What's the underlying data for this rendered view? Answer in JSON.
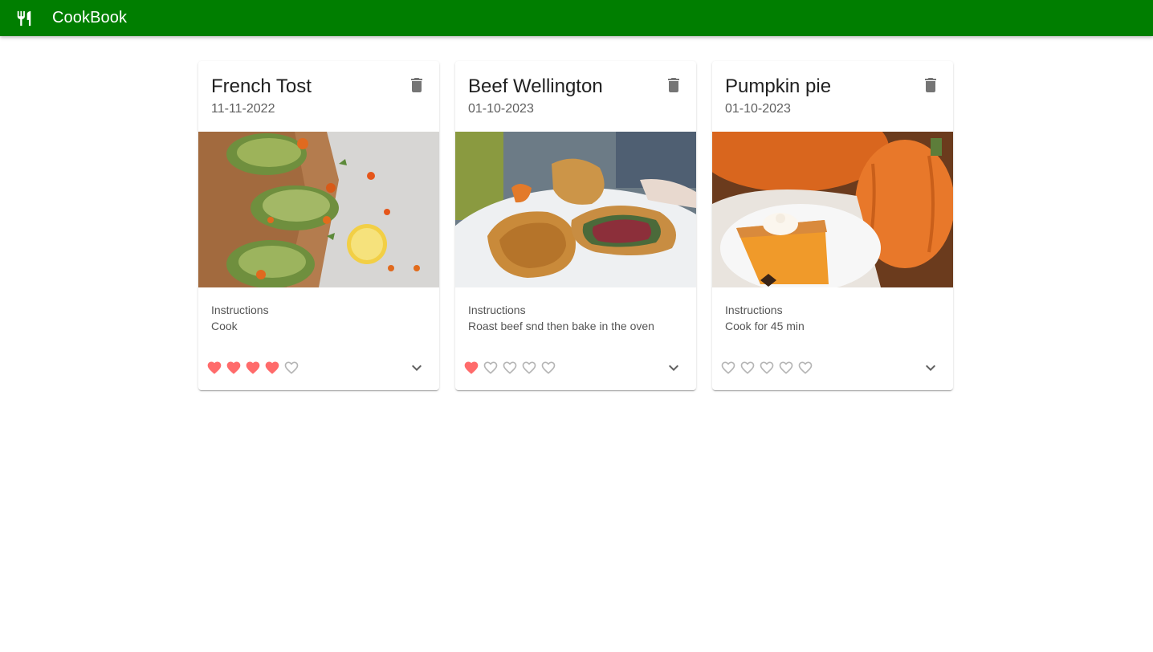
{
  "appbar": {
    "title": "CookBook",
    "icon": "restaurant-icon",
    "background": "#007e00"
  },
  "rating_color_filled": "#ff6b6b",
  "rating_color_empty": "#b5b5b5",
  "recipes": [
    {
      "title": "French Tost",
      "date": "11-11-2022",
      "instructions_label": "Instructions",
      "instructions": "Cook",
      "rating": 4,
      "rating_max": 5,
      "image": "avocado-toast-photo"
    },
    {
      "title": "Beef Wellington",
      "date": "01-10-2023",
      "instructions_label": "Instructions",
      "instructions": "Roast beef snd then bake in the oven",
      "rating": 1,
      "rating_max": 5,
      "image": "beef-wellington-photo"
    },
    {
      "title": "Pumpkin pie",
      "date": "01-10-2023",
      "instructions_label": "Instructions",
      "instructions": "Cook for 45 min",
      "rating": 0,
      "rating_max": 5,
      "image": "pumpkin-pie-photo"
    }
  ]
}
